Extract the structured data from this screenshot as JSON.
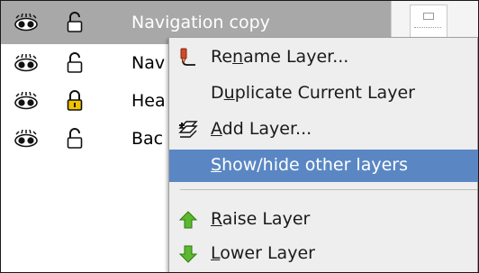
{
  "layers": [
    {
      "name": "Navigation copy",
      "visible_icon": "eye-icon",
      "lock_icon": "lock-open-icon",
      "selected": true
    },
    {
      "name": "Nav",
      "visible_icon": "eye-icon",
      "lock_icon": "lock-open-icon",
      "selected": false
    },
    {
      "name": "Hea",
      "visible_icon": "eye-icon",
      "lock_icon": "lock-closed-icon",
      "selected": false
    },
    {
      "name": "Bac",
      "visible_icon": "eye-icon",
      "lock_icon": "lock-open-icon",
      "selected": false
    }
  ],
  "context_menu": {
    "items": [
      {
        "pre": "Re",
        "mnemonic": "n",
        "post": "ame Layer...",
        "icon": "rename-icon",
        "highlighted": false
      },
      {
        "pre": "D",
        "mnemonic": "u",
        "post": "plicate Current Layer",
        "icon": "",
        "highlighted": false
      },
      {
        "pre": "",
        "mnemonic": "A",
        "post": "dd Layer...",
        "icon": "add-layer-icon",
        "highlighted": false
      },
      {
        "pre": "",
        "mnemonic": "S",
        "post": "how/hide other layers",
        "icon": "",
        "highlighted": true
      },
      {
        "pre": "",
        "mnemonic": "R",
        "post": "aise Layer",
        "icon": "raise-arrow-icon",
        "highlighted": false
      },
      {
        "pre": "",
        "mnemonic": "L",
        "post": "ower Layer",
        "icon": "lower-arrow-icon",
        "highlighted": false
      }
    ]
  },
  "colors": {
    "selected_row": "#a8a8a8",
    "menu_highlight": "#5a87c4",
    "arrow_green": "#5cb82e"
  }
}
